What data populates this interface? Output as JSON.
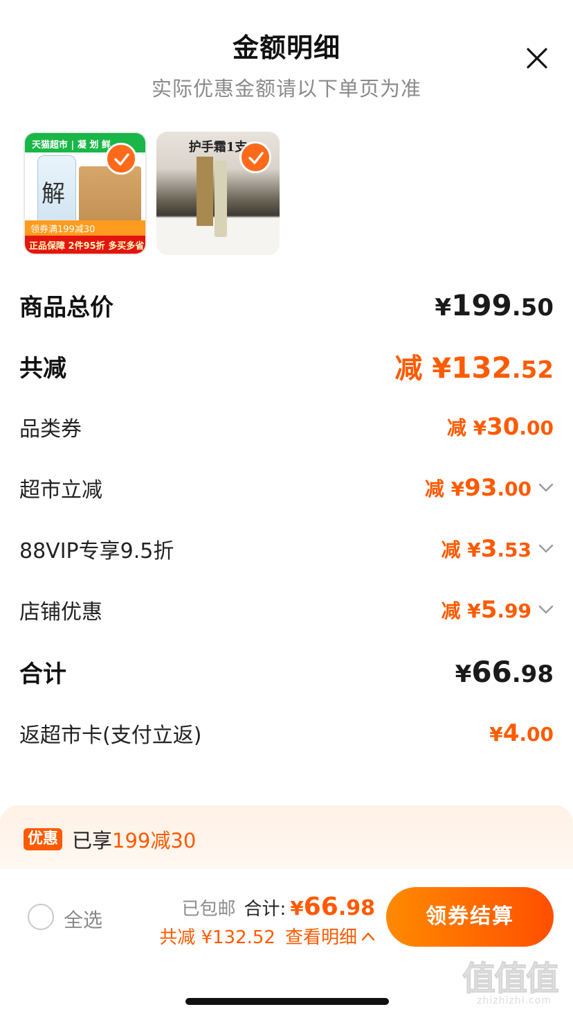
{
  "header": {
    "title": "金额明细",
    "subtitle": "实际优惠金额请以下单页为准"
  },
  "icons": {
    "close": "close-icon",
    "check": "check-icon",
    "chevron": "chevron-down-icon",
    "chevron_up": "chevron-up-icon"
  },
  "products": [
    {
      "top_text": "天猫超市 | 凝 划 鲜",
      "big_char": "解",
      "strip1": "领券满199减30",
      "strip2": "正品保障  2件95折 多买多省"
    },
    {
      "title": "护手霜1支"
    }
  ],
  "rows": [
    {
      "label": "商品总价",
      "prefix": "¥",
      "int": "199",
      "dec": ".50",
      "color": "black"
    },
    {
      "label": "共减",
      "prefix": "减 ¥",
      "int": "132",
      "dec": ".52",
      "color": "orange"
    },
    {
      "label": "品类券",
      "prefix": "减 ¥",
      "int": "30",
      "dec": ".00",
      "color": "orange"
    },
    {
      "label": "超市立减",
      "prefix": "减 ¥",
      "int": "93",
      "dec": ".00",
      "color": "orange"
    },
    {
      "label": "88VIP专享9.5折",
      "prefix": "减 ¥",
      "int": "3",
      "dec": ".53",
      "color": "orange"
    },
    {
      "label": "店铺优惠",
      "prefix": "减 ¥",
      "int": "5",
      "dec": ".99",
      "color": "orange"
    },
    {
      "label": "合计",
      "prefix": "¥",
      "int": "66",
      "dec": ".98",
      "color": "black"
    },
    {
      "label": "返超市卡(支付立返)",
      "prefix": "¥",
      "int": "4",
      "dec": ".00",
      "color": "orange"
    }
  ],
  "promo": {
    "badge": "优惠",
    "text_prefix": "已享",
    "text_highlight": "199减30"
  },
  "footer": {
    "select_all": "全选",
    "shipping": "已包邮",
    "total_label": "合计:",
    "total_prefix": "¥",
    "total_int": "66",
    "total_dec": ".98",
    "reduce_text": "共减 ¥132.52",
    "view_details": "查看明细",
    "checkout": "领券结算"
  },
  "watermark": {
    "chars": "值值值",
    "url": "zhizhizhi.com"
  },
  "colors": {
    "accent": "#ff5a00",
    "checkout_gradient_start": "#ff8a00",
    "checkout_gradient_end": "#ff4f00",
    "promo_bg": "#fff1e6"
  }
}
